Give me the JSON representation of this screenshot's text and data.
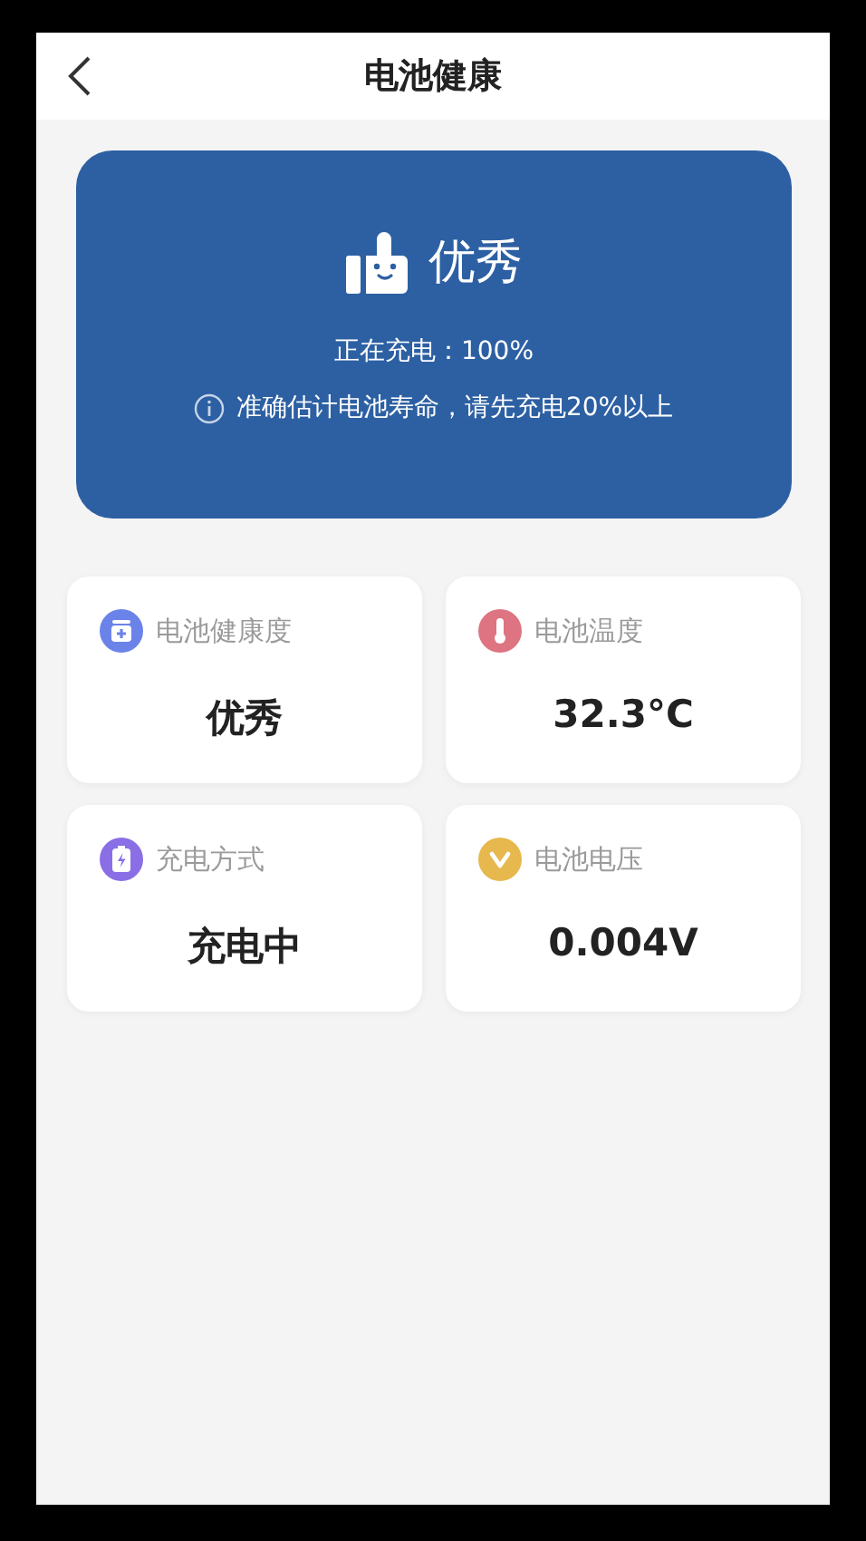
{
  "header": {
    "title": "电池健康"
  },
  "summary": {
    "rating": "优秀",
    "charging": "正在充电：100%",
    "tip": "准确估计电池寿命，请先充电20%以上"
  },
  "stats": [
    {
      "kind": "health",
      "color": "#6b83e8",
      "label": "电池健康度",
      "value": "优秀"
    },
    {
      "kind": "temperature",
      "color": "#de7482",
      "label": "电池温度",
      "value": "32.3°C"
    },
    {
      "kind": "charging",
      "color": "#8a6ee6",
      "label": "充电方式",
      "value": "充电中"
    },
    {
      "kind": "voltage",
      "color": "#e6b84e",
      "label": "电池电压",
      "value": "0.004V"
    }
  ]
}
